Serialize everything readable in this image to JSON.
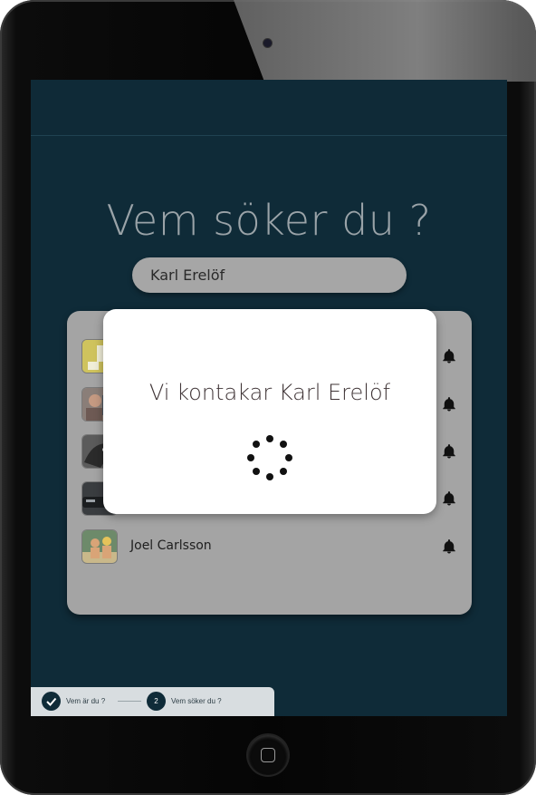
{
  "heading": "Vem söker du ?",
  "search": {
    "value": "Karl Erelöf"
  },
  "people": [
    {
      "name": "",
      "avatar": "yellow-logo-avatar"
    },
    {
      "name": "",
      "avatar": "person-photo-avatar"
    },
    {
      "name": "",
      "avatar": "animal-photo-avatar"
    },
    {
      "name": "",
      "avatar": "car-photo-avatar"
    },
    {
      "name": "Joel Carlsson",
      "avatar": "beach-photo-avatar"
    }
  ],
  "dialog": {
    "message": "Vi kontakar Karl Erelöf",
    "icon": "loading-spinner"
  },
  "stepper": {
    "steps": [
      {
        "label": "Vem är du ?",
        "state": "done"
      },
      {
        "label": "Vem söker du ?",
        "number": "2",
        "state": "active"
      }
    ]
  },
  "colors": {
    "screen_bg": "#0f2b38",
    "card_bg": "#a4a4a4",
    "dialog_bg": "#ffffff"
  }
}
